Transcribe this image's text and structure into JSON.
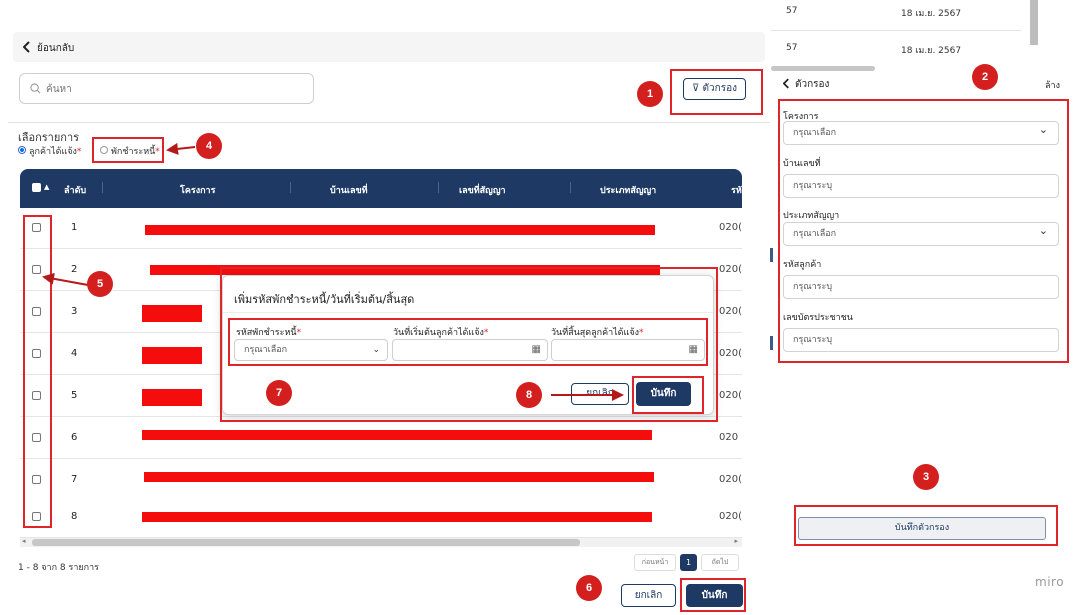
{
  "header": {
    "back_label": "ย้อนกลับ"
  },
  "search": {
    "placeholder": "ค้นหา"
  },
  "filter_button": {
    "label": "ตัวกรอง"
  },
  "selection": {
    "title": "เลือกรายการ",
    "options": [
      {
        "label": "ลูกค้าได้แจ้ง",
        "selected": true
      },
      {
        "label": "พักชำระหนี้",
        "selected": false
      }
    ],
    "required_mark": "*"
  },
  "table": {
    "columns": [
      "ลำดับ",
      "โครงการ",
      "บ้านเลขที่",
      "เลขที่สัญญา",
      "ประเภทสัญญา",
      "รหั"
    ],
    "rows": [
      {
        "index": "1",
        "code": "020("
      },
      {
        "index": "2",
        "code": "020("
      },
      {
        "index": "3",
        "code": "020("
      },
      {
        "index": "4",
        "code": "020("
      },
      {
        "index": "5",
        "code": "020("
      },
      {
        "index": "6",
        "code": "020"
      },
      {
        "index": "7",
        "code": "020("
      },
      {
        "index": "8",
        "code": "020("
      }
    ],
    "range_label": "1 - 8 จาก 8 รายการ",
    "pagination": {
      "prev": "ก่อนหน้า",
      "current": "1",
      "next": "ถัดไป"
    }
  },
  "footer": {
    "cancel_label": "ยกเลิก",
    "save_label": "บันทึก"
  },
  "modal": {
    "title": "เพิ่มรหัสพักชำระหนี้/วันที่เริ่มต้น/สิ้นสุด",
    "fields": {
      "code_label": "รหัสพักชำระหนี้",
      "code_value": "กรุณาเลือก",
      "start_label": "วันที่เริ่มต้นลูกค้าได้แจ้ง",
      "end_label": "วันที่สิ้นสุดลูกค้าได้แจ้ง"
    },
    "cancel_label": "ยกเลิก",
    "save_label": "บันทึก"
  },
  "filter_panel": {
    "title": "ตัวกรอง",
    "clear_label": "ล้าง",
    "top_rows": [
      {
        "left": "57",
        "date": "18 เม.ย. 2567"
      },
      {
        "left": "57",
        "date": "18 เม.ย. 2567"
      }
    ],
    "fields": [
      {
        "label": "โครงการ",
        "value": "กรุณาเลือก",
        "type": "select"
      },
      {
        "label": "บ้านเลขที่",
        "value": "กรุณาระบุ",
        "type": "input"
      },
      {
        "label": "ประเภทสัญญา",
        "value": "กรุณาเลือก",
        "type": "select"
      },
      {
        "label": "รหัสลูกค้า",
        "value": "กรุณาระบุ",
        "type": "input"
      },
      {
        "label": "เลขบัตรประชาชน",
        "value": "กรุณาระบุ",
        "type": "input"
      }
    ],
    "save_filter_label": "บันทึกตัวกรอง"
  },
  "annotations": [
    "1",
    "2",
    "3",
    "4",
    "5",
    "6",
    "7",
    "8"
  ],
  "watermark": "miro",
  "colors": {
    "primary": "#1e3a64",
    "annotation_red": "#e0252a",
    "redaction": "#f50d0d"
  }
}
